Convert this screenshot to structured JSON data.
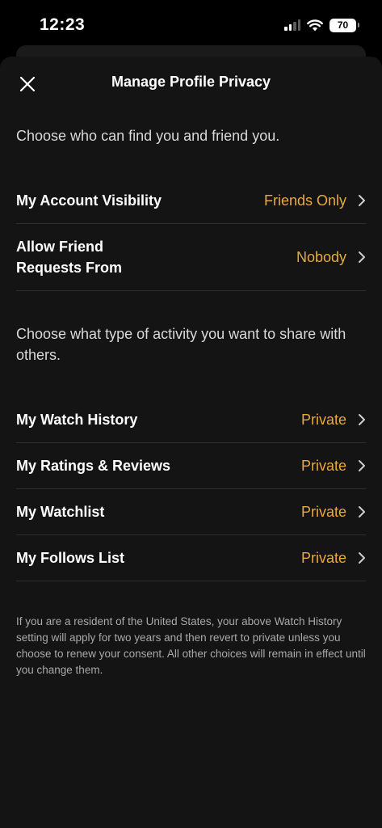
{
  "status_bar": {
    "time": "12:23",
    "battery": "70"
  },
  "header": {
    "title": "Manage Profile Privacy",
    "close_icon": "close-icon"
  },
  "find_section": {
    "description": "Choose who can find you and friend you.",
    "rows": [
      {
        "label": "My Account Visibility",
        "value": "Friends Only"
      },
      {
        "label": "Allow Friend Requests From",
        "value": "Nobody"
      }
    ]
  },
  "activity_section": {
    "description": "Choose what type of activity you want to share with others.",
    "rows": [
      {
        "label": "My Watch History",
        "value": "Private"
      },
      {
        "label": "My Ratings & Reviews",
        "value": "Private"
      },
      {
        "label": "My Watchlist",
        "value": "Private"
      },
      {
        "label": "My Follows List",
        "value": "Private"
      }
    ]
  },
  "footnote": "If you are a resident of the United States, your above Watch History setting will apply for two years and then revert to private unless you choose to renew your consent. All other choices will remain in effect until you change them.",
  "colors": {
    "accent": "#e9a93a",
    "background": "#141414",
    "divider": "#2e2e2e"
  }
}
